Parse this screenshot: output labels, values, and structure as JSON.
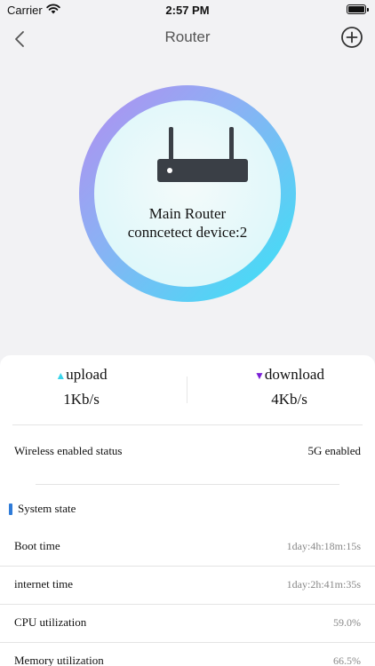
{
  "status_bar": {
    "carrier": "Carrier",
    "time": "2:57 PM",
    "icons": [
      "wifi-icon",
      "battery-icon"
    ]
  },
  "nav": {
    "title": "Router",
    "back_icon": "chevron-left-icon",
    "add_icon": "plus-circle-icon"
  },
  "router": {
    "name": "Main Router",
    "connected_devices": "conncetect device:2"
  },
  "speeds": {
    "upload_arrow": "▲",
    "upload_label": "upload",
    "upload_value": "1Kb/s",
    "download_arrow": "▼",
    "download_label": "download",
    "download_value": "4Kb/s"
  },
  "wireless": {
    "label": "Wireless enabled status",
    "value": "5G enabled"
  },
  "system_state": {
    "title": "System state",
    "rows": [
      {
        "label": "Boot time",
        "value": "1day:4h:18m:15s"
      },
      {
        "label": "internet time",
        "value": "1day:2h:41m:35s"
      },
      {
        "label": "CPU utilization",
        "value": "59.0%"
      },
      {
        "label": "Memory utilization",
        "value": "66.5%"
      }
    ]
  },
  "colors": {
    "ring_start": "#b48cf0",
    "ring_end": "#38e4f6",
    "upload_arrow": "#38d4ea",
    "download_arrow": "#7a1fd6",
    "section_accent": "#2f7bd8"
  }
}
